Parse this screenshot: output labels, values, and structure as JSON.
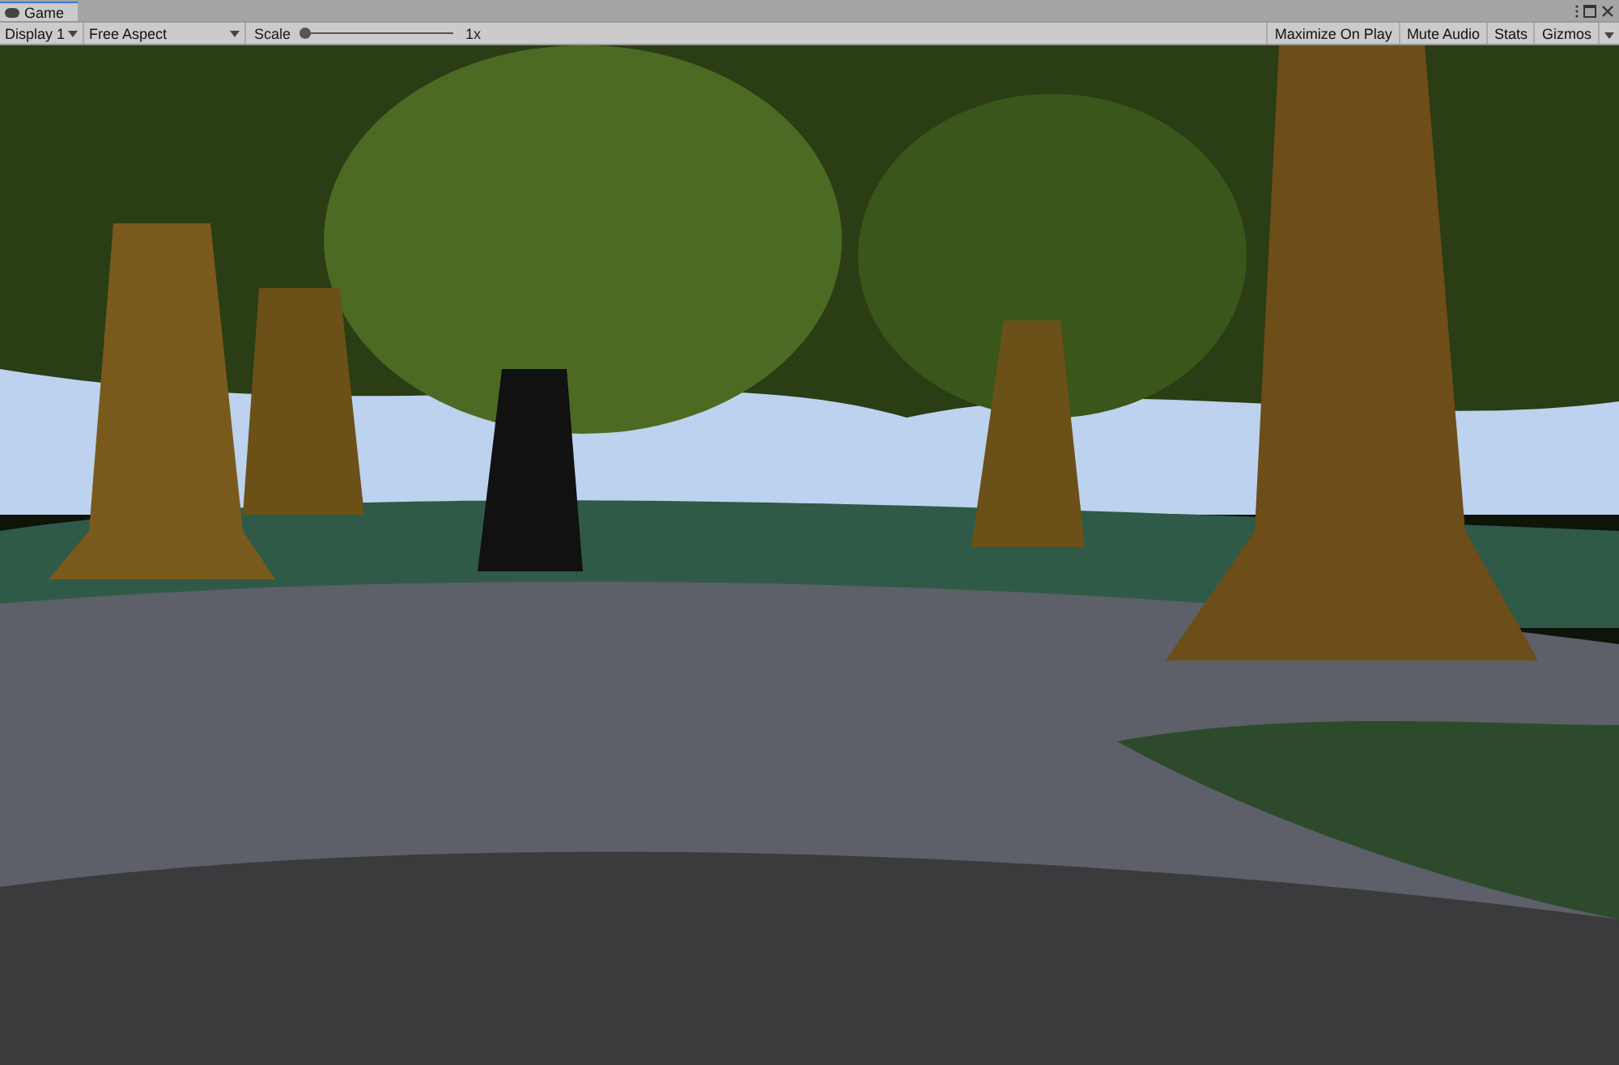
{
  "tab": {
    "title": "Game",
    "selected": true
  },
  "toolbar": {
    "display": "Display 1",
    "aspect": "Free Aspect",
    "scale": {
      "label": "Scale",
      "level": 0,
      "reading": "1x"
    },
    "toggles": [
      {
        "label": "Maximize On Play",
        "selected": false
      },
      {
        "label": "Mute Audio",
        "selected": false
      },
      {
        "label": "Stats",
        "selected": false
      }
    ],
    "gizmos": "Gizmos"
  }
}
